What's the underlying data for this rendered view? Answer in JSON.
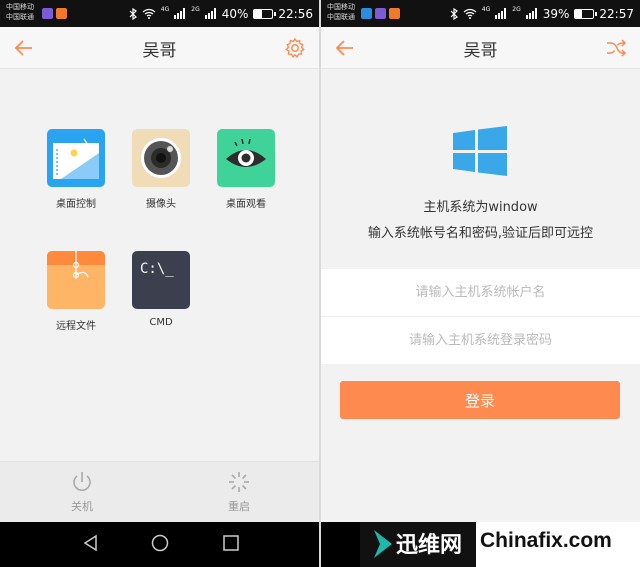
{
  "left_screen": {
    "status": {
      "carrier_1": "中国移动",
      "carrier_2": "中国联通",
      "network_4g": "4G",
      "network_2g": "2G",
      "battery": "40%",
      "battery_level": 0.4,
      "time": "22:56"
    },
    "title": "吴哥",
    "apps": [
      {
        "label": "桌面控制",
        "icon": "desktop-control-icon"
      },
      {
        "label": "摄像头",
        "icon": "camera-icon"
      },
      {
        "label": "桌面观看",
        "icon": "eye-icon"
      },
      {
        "label": "远程文件",
        "icon": "folder-icon"
      },
      {
        "label": "CMD",
        "icon": "terminal-icon",
        "tile_text": "C:\\_"
      }
    ],
    "bottom": {
      "shutdown_label": "关机",
      "restart_label": "重启"
    }
  },
  "right_screen": {
    "status": {
      "carrier_1": "中国移动",
      "carrier_2": "中国联通",
      "network_4g": "4G",
      "network_2g": "2G",
      "battery": "39%",
      "battery_level": 0.39,
      "time": "22:57"
    },
    "title": "吴哥",
    "info_line_1": "主机系统为window",
    "info_line_2": "输入系统帐号名和密码,验证后即可远控",
    "username_placeholder": "请输入主机系统帐户名",
    "password_placeholder": "请输入主机系统登录密码",
    "login_label": "登录"
  },
  "watermark": {
    "cn": "迅维网",
    "en": "Chinafix.com"
  },
  "colors": {
    "accent": "#ff8a50",
    "desktop_tile": "#2aa3f0",
    "camera_tile": "#f1dcb8",
    "eye_tile": "#3fd39a",
    "folder_tile": "#ffb566",
    "cmd_tile": "#3c3f4e",
    "windows_blue": "#3aa8e8"
  }
}
